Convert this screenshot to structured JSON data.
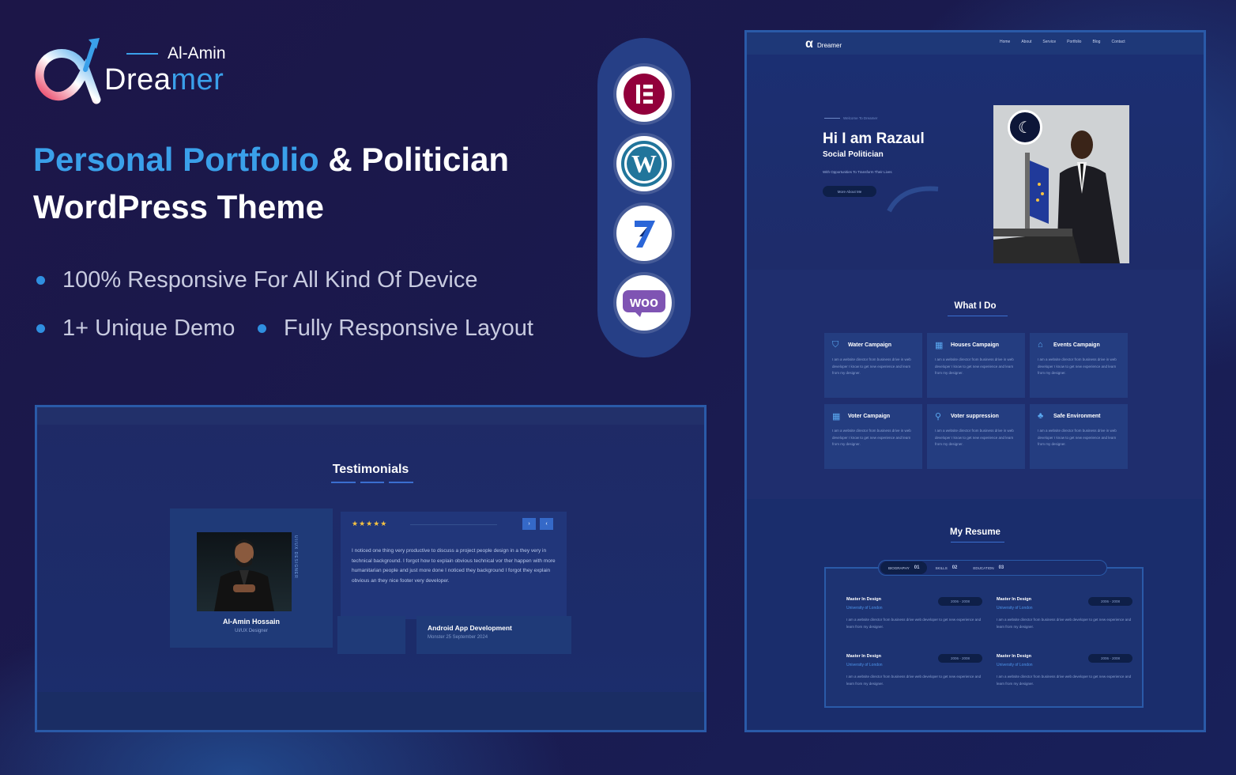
{
  "brand": {
    "top_word": "Al-Amin",
    "name_a": "Drea",
    "name_b": "mer",
    "colors": {
      "accent": "#3aa0ea",
      "pill": "#263f86",
      "panel_border": "#2a5aa8",
      "background": "#1a1545"
    }
  },
  "headline": {
    "highlight": "Personal Portfolio",
    "rest": " & Politician",
    "line2": "WordPress Theme"
  },
  "features": [
    "100% Responsive For All Kind Of Device",
    "1+ Unique Demo",
    "Fully Responsive Layout"
  ],
  "plugins": [
    {
      "name": "elementor-icon",
      "color": "#92003b"
    },
    {
      "name": "wordpress-icon",
      "color": "#21759b"
    },
    {
      "name": "seven-icon",
      "color": "#2b66d8"
    },
    {
      "name": "woocommerce-icon",
      "color": "#7f54b3"
    }
  ],
  "testimonials": {
    "title": "Testimonials",
    "person_name": "Al-Amin Hossain",
    "person_role": "UI/UX Designer",
    "vertical_text": "UI/UX DESIGNER",
    "stars": "★★★★★",
    "nav_next": "›",
    "nav_prev": "‹",
    "quote": "I noticed one thing very productive to discuss a project people design in a they very in technical background. I forgot how to explain obvious technical vor ther happen with more humanitarian people and just more done I noticed they background I forgot they explain obvious an they nice footer very developer.",
    "bottom_card_title": "Android App Development",
    "bottom_card_sub": "Monster 25 September 2024"
  },
  "site": {
    "logo_mark": "α",
    "logo_text": "Dreamer",
    "nav": [
      "Home",
      "About",
      "Service",
      "Portfolio",
      "Blog",
      "Contact"
    ],
    "hero": {
      "welcome": "Welcome To Dreamer",
      "greeting": "Hi I am Razaul",
      "role": "Social Politician",
      "tagline": "With Opportunities To Transform Their Lives",
      "button": "More About Me"
    },
    "what_i_do": {
      "title": "What I Do",
      "services": [
        {
          "title": "Water Campaign",
          "icon": "shield-icon"
        },
        {
          "title": "Houses Campaign",
          "icon": "calendar-icon"
        },
        {
          "title": "Events Campaign",
          "icon": "home-icon"
        },
        {
          "title": "Voter Campaign",
          "icon": "calendar-icon"
        },
        {
          "title": "Voter suppression",
          "icon": "link-icon"
        },
        {
          "title": "Safe Environment",
          "icon": "tree-icon"
        }
      ],
      "service_text": "I am a website director from business drive in web developer I know to get new experience and learn from my designer."
    },
    "resume": {
      "title": "My Resume",
      "tabs": [
        {
          "label": "BIOGRAPHY",
          "num": "01"
        },
        {
          "label": "SKILLS",
          "num": "02"
        },
        {
          "label": "EDUCATION",
          "num": "03"
        }
      ],
      "items": [
        {
          "title": "Master In Design",
          "uni": "University of London",
          "years": "2006 - 2008"
        },
        {
          "title": "Master In Design",
          "uni": "University of London",
          "years": "2006 - 2008"
        },
        {
          "title": "Master In Design",
          "uni": "University of London",
          "years": "2006 - 2008"
        },
        {
          "title": "Master In Design",
          "uni": "University of London",
          "years": "2006 - 2008"
        }
      ],
      "item_text": "I am a website director from business drive web developer to get new experience and learn from my designer."
    }
  }
}
